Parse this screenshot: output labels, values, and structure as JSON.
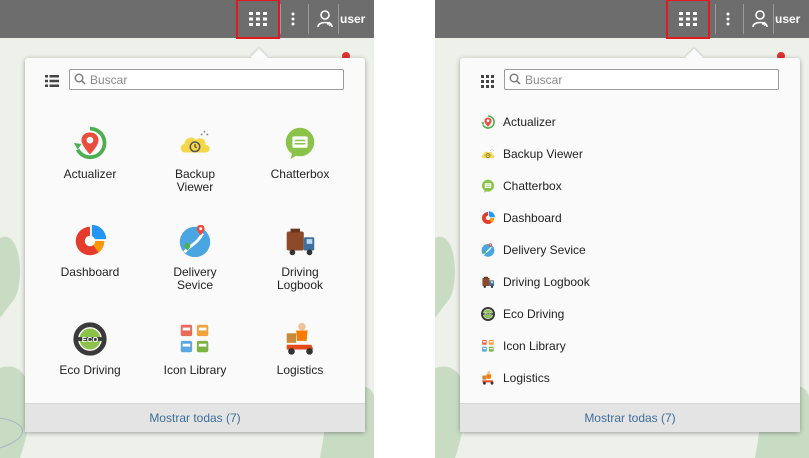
{
  "colors": {
    "topbar": "#6d6d6d",
    "highlight": "#e0191e",
    "link": "#3f6e9a",
    "footer_bg": "#e4e4e4"
  },
  "topbar": {
    "apps_icon": "grid-apps-icon",
    "more_icon": "kebab-icon",
    "user_icon": "user-icon",
    "user_label": "user"
  },
  "search": {
    "placeholder": "Buscar",
    "value": ""
  },
  "footer": {
    "show_all_label": "Mostrar todas (7)"
  },
  "grid_view": {
    "toggle_icon": "list-view-icon",
    "apps": [
      {
        "label": "Actualizer",
        "icon": "actualizer-icon"
      },
      {
        "label": "Backup\nViewer",
        "icon": "backup-viewer-icon"
      },
      {
        "label": "Chatterbox",
        "icon": "chatterbox-icon"
      },
      {
        "label": "Dashboard",
        "icon": "dashboard-icon"
      },
      {
        "label": "Delivery\nSevice",
        "icon": "delivery-sevice-icon"
      },
      {
        "label": "Driving\nLogbook",
        "icon": "driving-logbook-icon"
      },
      {
        "label": "Eco Driving",
        "icon": "eco-driving-icon"
      },
      {
        "label": "Icon Library",
        "icon": "icon-library-icon"
      },
      {
        "label": "Logistics",
        "icon": "logistics-icon"
      }
    ]
  },
  "list_view": {
    "toggle_icon": "grid-view-icon",
    "apps": [
      {
        "label": "Actualizer",
        "icon": "actualizer-icon"
      },
      {
        "label": "Backup Viewer",
        "icon": "backup-viewer-icon"
      },
      {
        "label": "Chatterbox",
        "icon": "chatterbox-icon"
      },
      {
        "label": "Dashboard",
        "icon": "dashboard-icon"
      },
      {
        "label": "Delivery Sevice",
        "icon": "delivery-sevice-icon"
      },
      {
        "label": "Driving Logbook",
        "icon": "driving-logbook-icon"
      },
      {
        "label": "Eco Driving",
        "icon": "eco-driving-icon"
      },
      {
        "label": "Icon Library",
        "icon": "icon-library-icon"
      },
      {
        "label": "Logistics",
        "icon": "logistics-icon"
      }
    ]
  }
}
